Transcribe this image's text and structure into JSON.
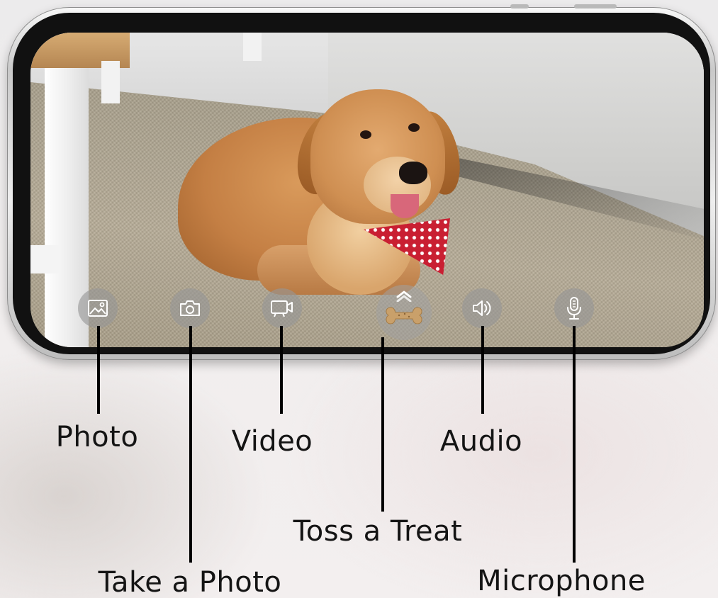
{
  "controls": [
    {
      "id": "photo",
      "label": "Photo",
      "icon": "gallery-icon"
    },
    {
      "id": "take-photo",
      "label": "Take a Photo",
      "icon": "camera-icon"
    },
    {
      "id": "video",
      "label": "Video",
      "icon": "video-camera-icon"
    },
    {
      "id": "toss-treat",
      "label": "Toss a Treat",
      "icon": "bone-treat-icon"
    },
    {
      "id": "audio",
      "label": "Audio",
      "icon": "speaker-icon"
    },
    {
      "id": "microphone",
      "label": "Microphone",
      "icon": "microphone-icon"
    }
  ],
  "callouts": {
    "photo": "Photo",
    "take_photo": "Take a Photo",
    "video": "Video",
    "toss_treat": "Toss a Treat",
    "audio": "Audio",
    "microphone": "Microphone"
  },
  "colors": {
    "button_fill": "#969696",
    "icon_stroke": "#ffffff",
    "callout_line": "#000000",
    "label_text": "#141414",
    "treat": "#c9a06a"
  }
}
